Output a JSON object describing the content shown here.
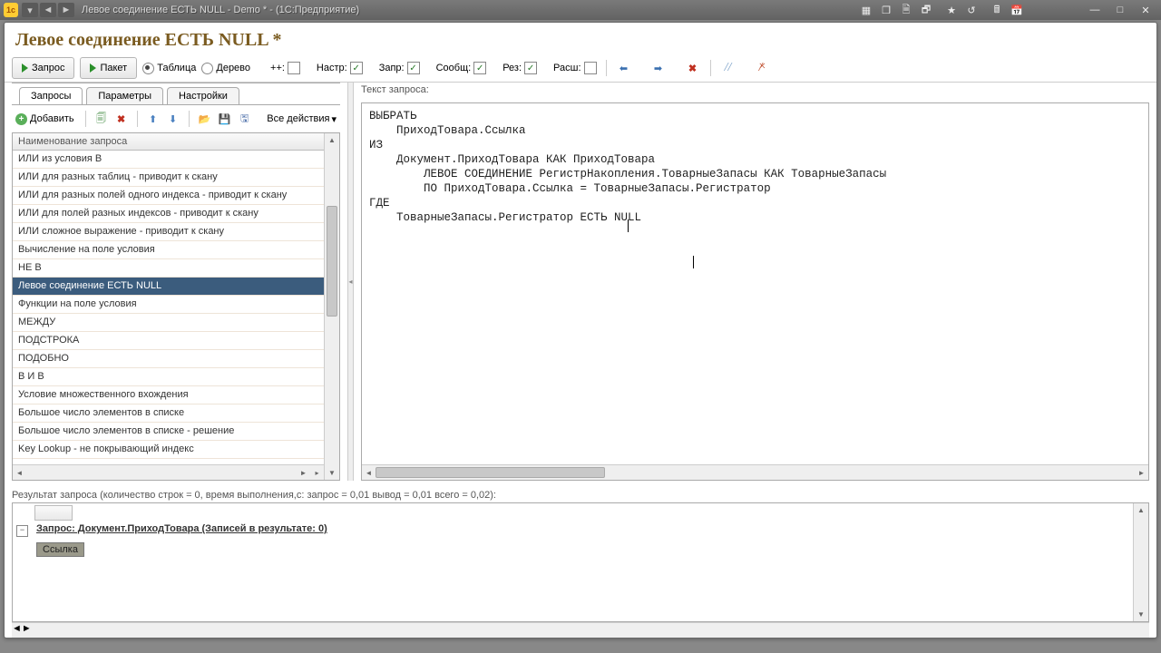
{
  "window": {
    "title": "Левое соединение ЕСТЬ NULL - Demo * - (1С:Предприятие)"
  },
  "page_title": "Левое соединение ЕСТЬ NULL *",
  "toolbar": {
    "run_query": "Запрос",
    "run_batch": "Пакет",
    "view_table": "Таблица",
    "view_tree": "Дерево",
    "plusplus": "++:",
    "nastr": "Настр:",
    "zapr": "Запр:",
    "soobsh": "Сообщ:",
    "pes": "Рез:",
    "rasch": "Расш:",
    "checks": {
      "plusplus": false,
      "nastr": true,
      "zapr": true,
      "soobsh": true,
      "pes": true,
      "rasch": false
    },
    "radio_selected": "table"
  },
  "tabs": {
    "queries": "Запросы",
    "params": "Параметры",
    "settings": "Настройки",
    "active": 0
  },
  "list_toolbar": {
    "add": "Добавить",
    "all_actions": "Все действия"
  },
  "list": {
    "header": "Наименование запроса",
    "items": [
      "ИЛИ из условия В",
      "ИЛИ для разных таблиц - приводит к скану",
      "ИЛИ для разных полей одного индекса - приводит к скану",
      "ИЛИ для полей разных индексов - приводит к скану",
      "ИЛИ сложное выражение - приводит к скану",
      "Вычисление на поле условия",
      "НЕ В",
      "Левое соединение ЕСТЬ NULL",
      "Функции на поле условия",
      "МЕЖДУ",
      "ПОДСТРОКА",
      "ПОДОБНО",
      "В И В",
      "Условие множественного вхождения",
      "Большое число элементов в списке",
      "Большое число элементов в списке - решение",
      "Key Lookup - не покрывающий индекс"
    ],
    "selected_index": 7
  },
  "query": {
    "label": "Текст запроса:",
    "text": "ВЫБРАТЬ\n    ПриходТовара.Ссылка\nИЗ\n    Документ.ПриходТовара КАК ПриходТовара\n        ЛЕВОЕ СОЕДИНЕНИЕ РегистрНакопления.ТоварныеЗапасы КАК ТоварныеЗапасы\n        ПО ПриходТовара.Ссылка = ТоварныеЗапасы.Регистратор\nГДЕ\n    ТоварныеЗапасы.Регистратор ЕСТЬ NULL"
  },
  "result": {
    "label": "Результат запроса (количество строк = 0, время выполнения,с: запрос = 0,01  вывод = 0,01  всего = 0,02):",
    "group_header": "Запрос: Документ.ПриходТовара (Записей в результате: 0)",
    "column": "Ссылка"
  },
  "colors": {
    "title": "#7a5b20",
    "selection": "#3b5c7d"
  }
}
